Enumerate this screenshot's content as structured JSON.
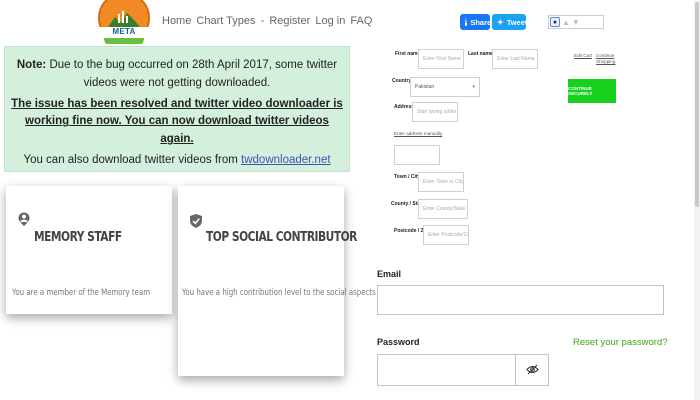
{
  "brand": {
    "logo_text": "META"
  },
  "nav": {
    "home": "Home",
    "chart_types": "Chart Types",
    "separator": "-",
    "register": "Register",
    "login": "Log in",
    "faq": "FAQ"
  },
  "social": {
    "share_label": "Share",
    "tweet_label": "Tweet",
    "facebook_color": "#1877f2",
    "twitter_color": "#1da1f2"
  },
  "notice": {
    "note_label": "Note:",
    "note_text": "Due to the bug occurred on 28th April 2017, some twitter videos were not getting downloaded.",
    "resolved_text": "The issue has been resolved and twitter video downloader is working fine now. You can now download twitter videos again.",
    "alt_text": "You can also download twitter videos from",
    "alt_link": "twdownloader.net",
    "background_color": "#d4f0dd"
  },
  "badges": [
    {
      "title": "MEMORY STAFF",
      "description": "You are a member of the Memory team",
      "icon": "person-badge-icon"
    },
    {
      "title": "TOP SOCIAL CONTRIBUTOR",
      "description": "You have a high contribution level to the social aspects",
      "icon": "check-shield-icon"
    }
  ],
  "address_form": {
    "first_name_label": "First name",
    "first_name_placeholder": "Enter First Name",
    "last_name_label": "Last name",
    "last_name_placeholder": "Enter Last Name",
    "country_label": "Country",
    "country_value": "Pakistan",
    "address_label": "Address",
    "address_placeholder": "Start typing address...",
    "enter_manually_link": "Enter address manually",
    "town_label": "Town / City",
    "town_placeholder": "Enter Town or City",
    "county_label": "County / State",
    "county_placeholder": "Enter County/State",
    "postcode_label": "Postcode / Zip",
    "postcode_placeholder": "Enter Postcode/Zip",
    "required_mark": "*",
    "edit_cart_link": "Edit Cart",
    "continue_shopping_link": "Continue Shopping",
    "continue_button": "CONTINUE SECURELY",
    "continue_color": "#18d11c"
  },
  "login": {
    "email_label": "Email",
    "password_label": "Password",
    "reset_link": "Reset your password?",
    "reset_color": "#3ea51d",
    "toggle_icon": "eye-slash-icon"
  }
}
